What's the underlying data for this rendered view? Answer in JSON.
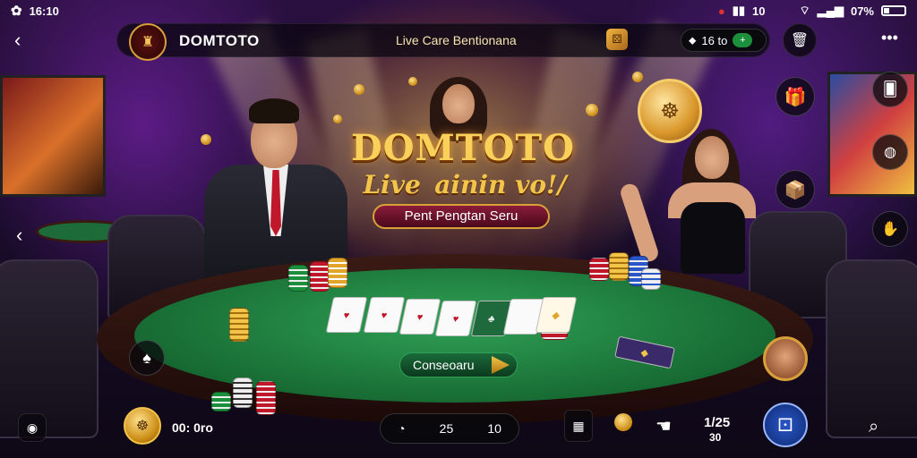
{
  "status_bar": {
    "time": "16:10",
    "notif_icon": "flower-icon",
    "right_signal_text": "10",
    "battery_text": "07%"
  },
  "header": {
    "brand_name": "DOMTOTO",
    "title": "Live Care Bentionana",
    "balance_text": "16 to",
    "balance_plus": "+"
  },
  "promo": {
    "title": "DOMTOTO",
    "subtitle": "Live  ainin vo!/",
    "banner": "Pent Pengtan Seru"
  },
  "table": {
    "continue_label": "Conseoaru"
  },
  "bottom_bar": {
    "coin_value": "00: 0ro",
    "pill_left": "25",
    "pill_right": "10",
    "stat_top": "1/25",
    "stat_bottom": "30"
  },
  "colors": {
    "felt": "#1f8a45",
    "gold": "#f3c44a",
    "accent_red": "#c0182a"
  }
}
